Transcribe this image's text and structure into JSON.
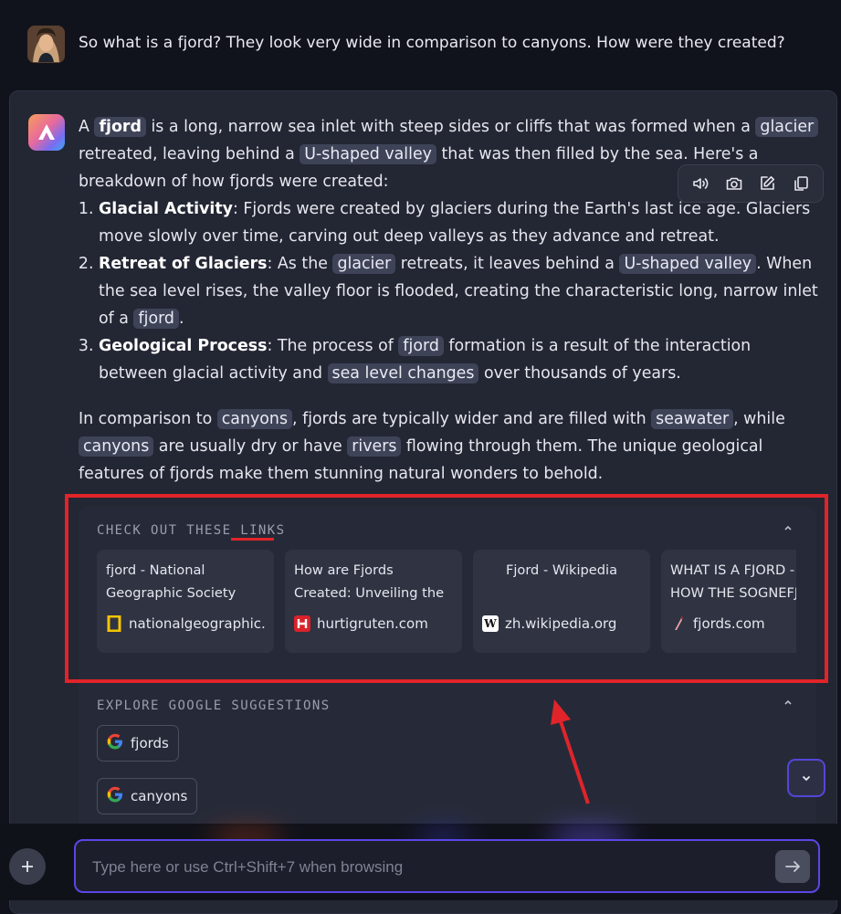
{
  "user": {
    "avatar_icon": "user-avatar",
    "message": "So what is a fjord? They look very wide in comparison to canyons. How were they created?"
  },
  "toolbar": {
    "icons": [
      "speaker-icon",
      "camera-icon",
      "edit-icon",
      "copy-icon"
    ]
  },
  "answer": {
    "p1": {
      "t1": "A ",
      "c1": "fjord",
      "t2": " is a long, narrow sea inlet with steep sides or cliffs that was formed when a ",
      "c2": "glacier",
      "t3": " retreated, leaving behind a ",
      "c3": "U-shaped valley",
      "t4": " that was then filled by the sea. Here's a breakdown of how fjords were created:"
    },
    "list": [
      {
        "label": "Glacial Activity",
        "t1": ": Fjords were created by glaciers during the Earth's last ice age. Glaciers move slowly over time, carving out deep valleys as they advance and retreat."
      },
      {
        "label": "Retreat of Glaciers",
        "t1": ": As the ",
        "c1": "glacier",
        "t2": " retreats, it leaves behind a ",
        "c2": "U-shaped valley",
        "t3": ". When the sea level rises, the valley floor is flooded, creating the characteristic long, narrow inlet of a ",
        "c3": "fjord",
        "t4": "."
      },
      {
        "label": "Geological Process",
        "t1": ": The process of ",
        "c1": "fjord",
        "t2": " formation is a result of the interaction between glacial activity and ",
        "c2": "sea level changes",
        "t3": " over thousands of years."
      }
    ],
    "p2": {
      "t1": "In comparison to ",
      "c1": "canyons",
      "t2": ", fjords are typically wider and are filled with ",
      "c2": "seawater",
      "t3": ", while ",
      "c3": "canyons",
      "t4": " are usually dry or have ",
      "c4": "rivers",
      "t5": " flowing through them. The unique geological features of fjords make them stunning natural wonders to behold."
    }
  },
  "links": {
    "title": "CHECK OUT THESE LINKS",
    "title_a": "CHECK OUT THESE ",
    "title_b": "LINKS",
    "cards": [
      {
        "title": "fjord - National Geographic Society",
        "source": "nationalgeographic.",
        "icon": "natgeo-icon"
      },
      {
        "title": "How are Fjords Created: Unveiling the Geologic...",
        "source": "hurtigruten.com",
        "icon": "hurtigruten-icon"
      },
      {
        "title": "Fjord - Wikipedia",
        "source": "zh.wikipedia.org",
        "icon": "wikipedia-icon"
      },
      {
        "title": "WHAT IS A FJORD - HOW THE SOGNEFJ...",
        "source": "fjords.com",
        "icon": "fjords-icon"
      }
    ]
  },
  "suggestions": {
    "title": "EXPLORE GOOGLE SUGGESTIONS",
    "items": [
      {
        "label": "fjords",
        "icon": "google-icon"
      },
      {
        "label": "canyons",
        "icon": "google-icon"
      }
    ]
  },
  "composer": {
    "placeholder": "Type here or use Ctrl+Shift+7 when browsing"
  },
  "colors": {
    "accent": "#5a47e6",
    "annotation_red": "#e0242a",
    "chip_bg": "#3f4358"
  }
}
